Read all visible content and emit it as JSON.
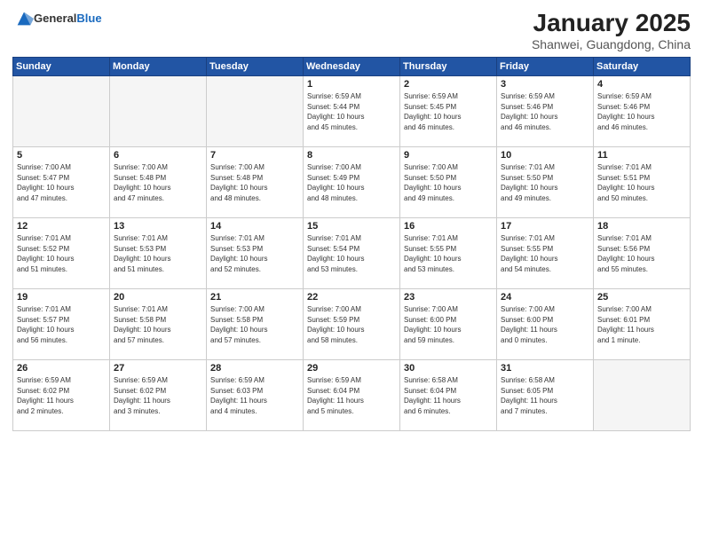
{
  "logo": {
    "general": "General",
    "blue": "Blue"
  },
  "title": {
    "month": "January 2025",
    "location": "Shanwei, Guangdong, China"
  },
  "weekdays": [
    "Sunday",
    "Monday",
    "Tuesday",
    "Wednesday",
    "Thursday",
    "Friday",
    "Saturday"
  ],
  "weeks": [
    [
      {
        "day": "",
        "info": ""
      },
      {
        "day": "",
        "info": ""
      },
      {
        "day": "",
        "info": ""
      },
      {
        "day": "1",
        "info": "Sunrise: 6:59 AM\nSunset: 5:44 PM\nDaylight: 10 hours\nand 45 minutes."
      },
      {
        "day": "2",
        "info": "Sunrise: 6:59 AM\nSunset: 5:45 PM\nDaylight: 10 hours\nand 46 minutes."
      },
      {
        "day": "3",
        "info": "Sunrise: 6:59 AM\nSunset: 5:46 PM\nDaylight: 10 hours\nand 46 minutes."
      },
      {
        "day": "4",
        "info": "Sunrise: 6:59 AM\nSunset: 5:46 PM\nDaylight: 10 hours\nand 46 minutes."
      }
    ],
    [
      {
        "day": "5",
        "info": "Sunrise: 7:00 AM\nSunset: 5:47 PM\nDaylight: 10 hours\nand 47 minutes."
      },
      {
        "day": "6",
        "info": "Sunrise: 7:00 AM\nSunset: 5:48 PM\nDaylight: 10 hours\nand 47 minutes."
      },
      {
        "day": "7",
        "info": "Sunrise: 7:00 AM\nSunset: 5:48 PM\nDaylight: 10 hours\nand 48 minutes."
      },
      {
        "day": "8",
        "info": "Sunrise: 7:00 AM\nSunset: 5:49 PM\nDaylight: 10 hours\nand 48 minutes."
      },
      {
        "day": "9",
        "info": "Sunrise: 7:00 AM\nSunset: 5:50 PM\nDaylight: 10 hours\nand 49 minutes."
      },
      {
        "day": "10",
        "info": "Sunrise: 7:01 AM\nSunset: 5:50 PM\nDaylight: 10 hours\nand 49 minutes."
      },
      {
        "day": "11",
        "info": "Sunrise: 7:01 AM\nSunset: 5:51 PM\nDaylight: 10 hours\nand 50 minutes."
      }
    ],
    [
      {
        "day": "12",
        "info": "Sunrise: 7:01 AM\nSunset: 5:52 PM\nDaylight: 10 hours\nand 51 minutes."
      },
      {
        "day": "13",
        "info": "Sunrise: 7:01 AM\nSunset: 5:53 PM\nDaylight: 10 hours\nand 51 minutes."
      },
      {
        "day": "14",
        "info": "Sunrise: 7:01 AM\nSunset: 5:53 PM\nDaylight: 10 hours\nand 52 minutes."
      },
      {
        "day": "15",
        "info": "Sunrise: 7:01 AM\nSunset: 5:54 PM\nDaylight: 10 hours\nand 53 minutes."
      },
      {
        "day": "16",
        "info": "Sunrise: 7:01 AM\nSunset: 5:55 PM\nDaylight: 10 hours\nand 53 minutes."
      },
      {
        "day": "17",
        "info": "Sunrise: 7:01 AM\nSunset: 5:55 PM\nDaylight: 10 hours\nand 54 minutes."
      },
      {
        "day": "18",
        "info": "Sunrise: 7:01 AM\nSunset: 5:56 PM\nDaylight: 10 hours\nand 55 minutes."
      }
    ],
    [
      {
        "day": "19",
        "info": "Sunrise: 7:01 AM\nSunset: 5:57 PM\nDaylight: 10 hours\nand 56 minutes."
      },
      {
        "day": "20",
        "info": "Sunrise: 7:01 AM\nSunset: 5:58 PM\nDaylight: 10 hours\nand 57 minutes."
      },
      {
        "day": "21",
        "info": "Sunrise: 7:00 AM\nSunset: 5:58 PM\nDaylight: 10 hours\nand 57 minutes."
      },
      {
        "day": "22",
        "info": "Sunrise: 7:00 AM\nSunset: 5:59 PM\nDaylight: 10 hours\nand 58 minutes."
      },
      {
        "day": "23",
        "info": "Sunrise: 7:00 AM\nSunset: 6:00 PM\nDaylight: 10 hours\nand 59 minutes."
      },
      {
        "day": "24",
        "info": "Sunrise: 7:00 AM\nSunset: 6:00 PM\nDaylight: 11 hours\nand 0 minutes."
      },
      {
        "day": "25",
        "info": "Sunrise: 7:00 AM\nSunset: 6:01 PM\nDaylight: 11 hours\nand 1 minute."
      }
    ],
    [
      {
        "day": "26",
        "info": "Sunrise: 6:59 AM\nSunset: 6:02 PM\nDaylight: 11 hours\nand 2 minutes."
      },
      {
        "day": "27",
        "info": "Sunrise: 6:59 AM\nSunset: 6:02 PM\nDaylight: 11 hours\nand 3 minutes."
      },
      {
        "day": "28",
        "info": "Sunrise: 6:59 AM\nSunset: 6:03 PM\nDaylight: 11 hours\nand 4 minutes."
      },
      {
        "day": "29",
        "info": "Sunrise: 6:59 AM\nSunset: 6:04 PM\nDaylight: 11 hours\nand 5 minutes."
      },
      {
        "day": "30",
        "info": "Sunrise: 6:58 AM\nSunset: 6:04 PM\nDaylight: 11 hours\nand 6 minutes."
      },
      {
        "day": "31",
        "info": "Sunrise: 6:58 AM\nSunset: 6:05 PM\nDaylight: 11 hours\nand 7 minutes."
      },
      {
        "day": "",
        "info": ""
      }
    ]
  ]
}
